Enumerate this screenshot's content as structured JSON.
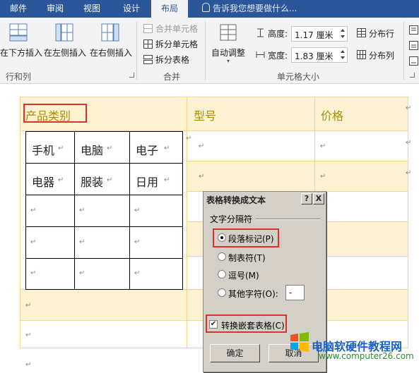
{
  "tabs": [
    "邮件",
    "审阅",
    "视图",
    "设计",
    "布局"
  ],
  "tell_me": "告诉我您想要做什么...",
  "ribbon": {
    "rows_cols": {
      "insert_below": "在下方插入",
      "insert_left": "在左侧插入",
      "insert_right": "在右侧插入",
      "group": "行和列"
    },
    "merge": {
      "merge_cells": "合并单元格",
      "split_cells": "拆分单元格",
      "split_table": "拆分表格",
      "group": "合并"
    },
    "cell_size": {
      "autofit": "自动调整",
      "height_label": "高度:",
      "height_value": "1.17 厘米",
      "width_label": "宽度:",
      "width_value": "1.83 厘米",
      "distribute_rows": "分布行",
      "distribute_cols": "分布列",
      "group": "单元格大小"
    }
  },
  "document": {
    "headers": [
      "产品类别",
      "型号",
      "价格"
    ],
    "inner_table": [
      [
        "手机",
        "电脑",
        "电子"
      ],
      [
        "电器",
        "服装",
        "日用"
      ],
      [
        "",
        "",
        ""
      ],
      [
        "",
        "",
        ""
      ],
      [
        "",
        "",
        ""
      ]
    ],
    "para_mark": "↵"
  },
  "dialog": {
    "title": "表格转换成文本",
    "help": "?",
    "close": "X",
    "section": "文字分隔符",
    "options": [
      {
        "label": "段落标记(P)",
        "selected": true
      },
      {
        "label": "制表符(T)",
        "selected": false
      },
      {
        "label": "逗号(M)",
        "selected": false
      },
      {
        "label": "其他字符(O):",
        "selected": false
      }
    ],
    "other_value": "-",
    "nested_checkbox": "转换嵌套表格(C)",
    "nested_checked": true,
    "ok": "确定",
    "cancel": "取消"
  },
  "watermark": {
    "title": "电脑软硬件教程网",
    "url": "www.computer26.com"
  },
  "colors": {
    "accent": "#2b579a",
    "highlight_row": "#fdf3d2",
    "header_text": "#b08b00",
    "red_box": "#d9342b"
  }
}
